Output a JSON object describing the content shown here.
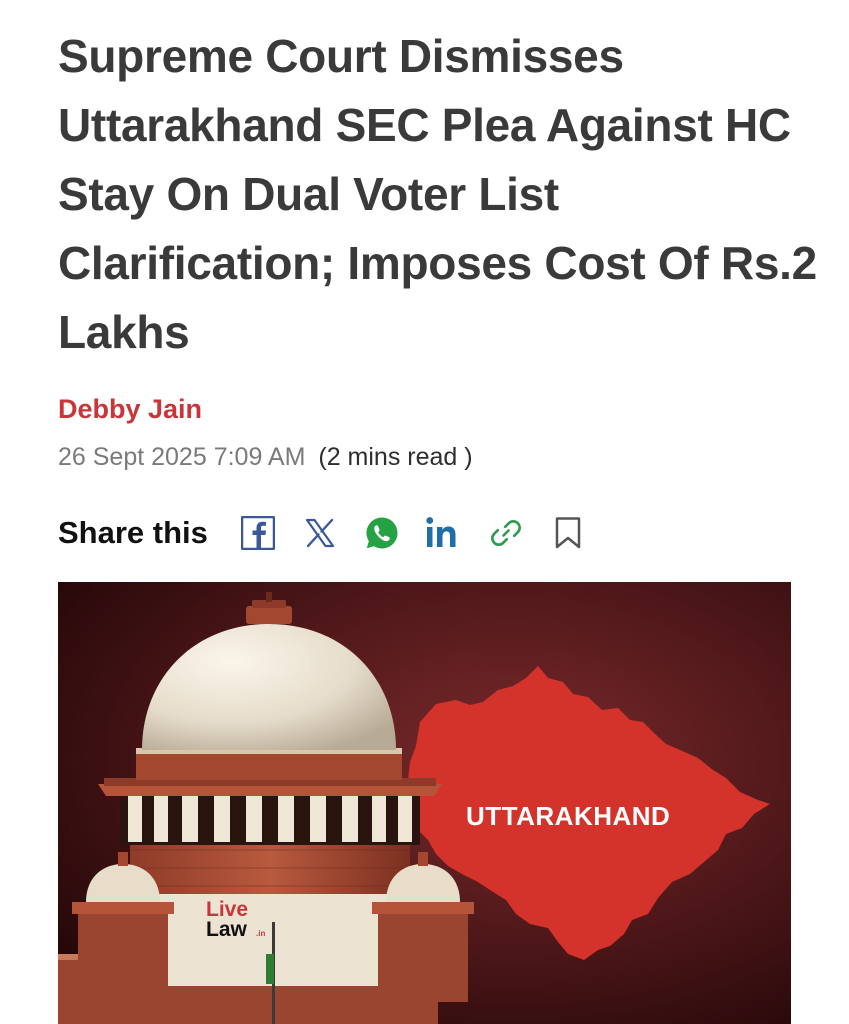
{
  "article": {
    "headline": "Supreme Court Dismisses Uttarakhand SEC Plea Against HC Stay On Dual Voter List Clarification; Imposes Cost Of Rs.2 Lakhs",
    "author": "Debby Jain",
    "date": "26 Sept 2025 7:09 AM",
    "read_time": "(2 mins read )"
  },
  "share": {
    "label": "Share this",
    "icons": [
      "facebook-icon",
      "x-icon",
      "whatsapp-icon",
      "linkedin-icon",
      "link-icon",
      "bookmark-icon"
    ]
  },
  "hero_image": {
    "state_label": "UTTARAKHAND",
    "logo": {
      "line1": "Live",
      "line2": "Law",
      "suffix": ".in"
    }
  },
  "colors": {
    "headline": "#3a3a3a",
    "author": "#c8363a",
    "meta": "#7a7a7a",
    "facebook": "#3b5998",
    "x": "#3b5998",
    "whatsapp": "#25a244",
    "linkedin": "#1f6ea8",
    "link": "#2e9b50",
    "bookmark": "#555555",
    "map_red": "#d4332c",
    "hero_background": "#3d1214"
  }
}
